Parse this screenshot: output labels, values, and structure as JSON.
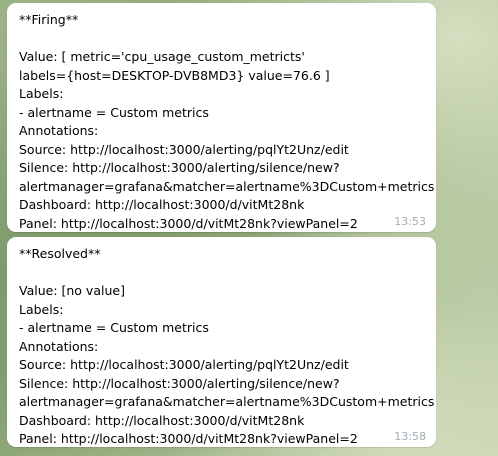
{
  "messages": [
    {
      "lines": [
        "**Firing**",
        "",
        "Value: [ metric='cpu_usage_custom_metricts'",
        "labels={host=DESKTOP-DVB8MD3} value=76.6 ]",
        "Labels:",
        " - alertname = Custom metrics",
        "Annotations:",
        "Source: http://localhost:3000/alerting/pqlYt2Unz/edit",
        "Silence: http://localhost:3000/alerting/silence/new?",
        "alertmanager=grafana&matcher=alertname%3DCustom+metrics",
        "Dashboard: http://localhost:3000/d/vitMt28nk",
        "Panel: http://localhost:3000/d/vitMt28nk?viewPanel=2"
      ],
      "time": "13:53"
    },
    {
      "lines": [
        "**Resolved**",
        "",
        "Value: [no value]",
        "Labels:",
        " - alertname = Custom metrics",
        "Annotations:",
        "Source: http://localhost:3000/alerting/pqlYt2Unz/edit",
        "Silence: http://localhost:3000/alerting/silence/new?",
        "alertmanager=grafana&matcher=alertname%3DCustom+metrics",
        "Dashboard: http://localhost:3000/d/vitMt28nk",
        "Panel: http://localhost:3000/d/vitMt28nk?viewPanel=2"
      ],
      "time": "13:58"
    }
  ]
}
